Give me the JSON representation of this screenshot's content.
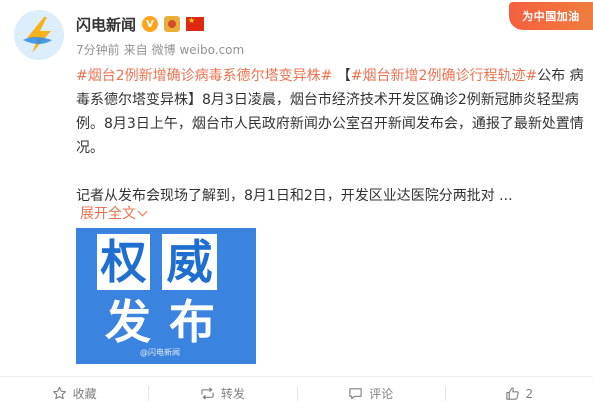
{
  "header": {
    "username": "闪电新闻",
    "verified_badge": "V",
    "meta": {
      "time": "7分钟前",
      "source_prefix": "来自",
      "source": "微博 weibo.com"
    },
    "corner_badge": "为中国加油"
  },
  "post": {
    "tag1": "#烟台2例新增确诊病毒系德尔塔变异株#",
    "bracket_open": "【",
    "tag2": "#烟台新增2例确诊行程轨迹#",
    "text1": "公布 病毒系德尔塔变异株】8月3日凌晨，烟台市经济技术开发区确诊2例新冠肺炎轻型病例。8月3日上午，烟台市人民政府新闻办公室召开新闻发布会，通报了最新处置情况。",
    "text2": "记者从发布会现场了解到，8月1日和2日，开发区业达医院分两批对 ...",
    "expand_label": "展开全文"
  },
  "media": {
    "chars": [
      "权",
      "威",
      "发",
      "布"
    ],
    "watermark": "@闪电新闻"
  },
  "actions": {
    "favorite": "收藏",
    "repost": "转发",
    "comment": "评论",
    "like_count": "2"
  },
  "colors": {
    "accent": "#eb7350",
    "media_bg": "#3a83de",
    "badge": "#ffa41b"
  },
  "icons": [
    "lightning-logo-icon",
    "verified-icon",
    "medal-icon",
    "flag-icon",
    "chevron-down-icon",
    "star-icon",
    "repost-icon",
    "comment-icon",
    "thumbs-up-icon"
  ]
}
